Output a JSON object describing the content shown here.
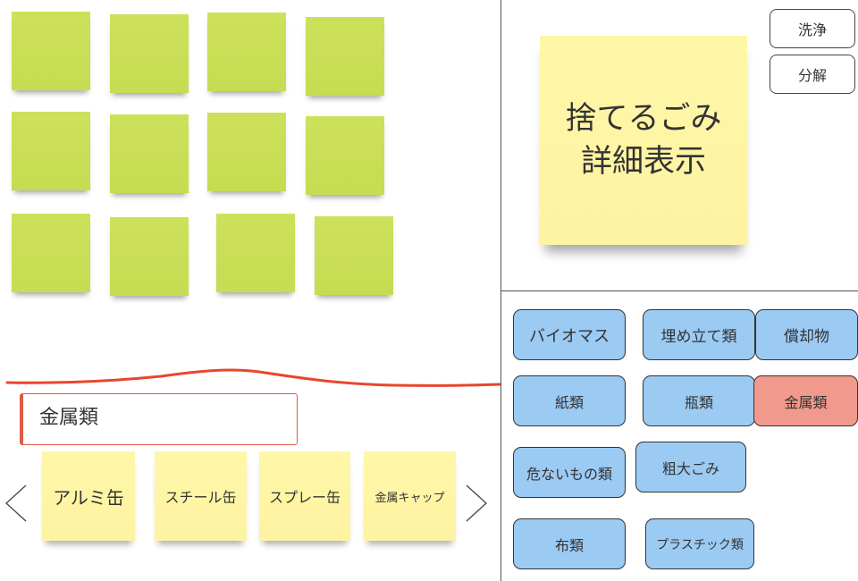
{
  "detail": {
    "title_line1": "捨てるごみ",
    "title_line2": "詳細表示"
  },
  "actions": {
    "wash": "洗浄",
    "disassemble": "分解"
  },
  "categories": [
    {
      "label": "バイオマス",
      "active": false
    },
    {
      "label": "埋め立て類",
      "active": false
    },
    {
      "label": "償却物",
      "active": false
    },
    {
      "label": "紙類",
      "active": false
    },
    {
      "label": "瓶類",
      "active": false
    },
    {
      "label": "金属類",
      "active": true
    },
    {
      "label": "危ないもの類",
      "active": false
    },
    {
      "label": "粗大ごみ",
      "active": false
    },
    {
      "label": "布類",
      "active": false
    },
    {
      "label": "プラスチック類",
      "active": false
    }
  ],
  "selected_category": "金属類",
  "items": [
    "アルミ缶",
    "スチール缶",
    "スプレー缶",
    "金属キャップ"
  ],
  "colors": {
    "green_note": "#c9de55",
    "yellow_note": "#fdf3a2",
    "category_blue": "#9bcaf3",
    "category_active": "#f0998c",
    "accent_red": "#e05a45"
  },
  "icons": {
    "prev": "chevron-left-icon",
    "next": "chevron-right-icon"
  }
}
